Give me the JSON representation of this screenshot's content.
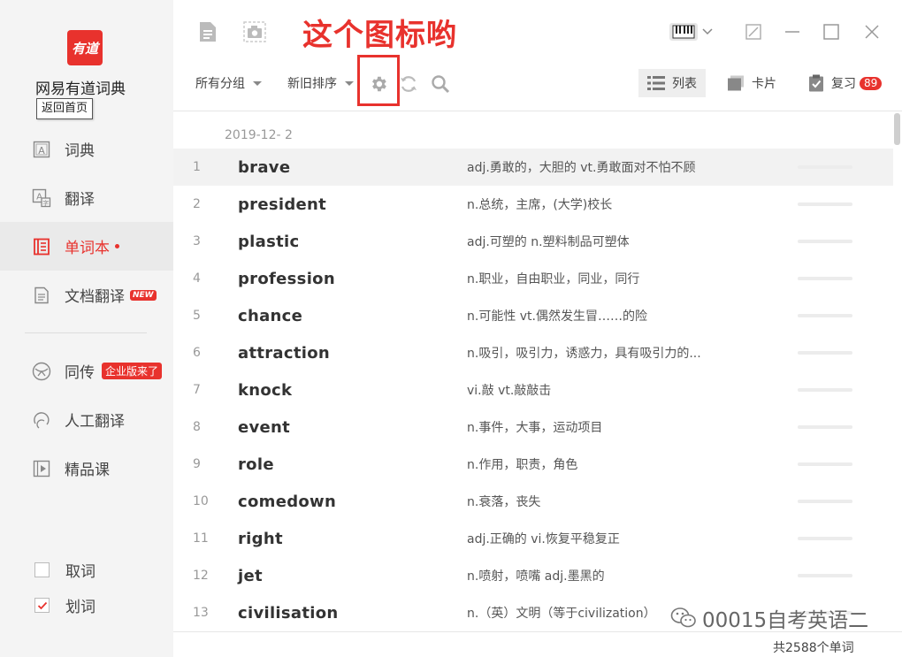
{
  "sidebar": {
    "logo_text": "有道",
    "app_name": "网易有道词典",
    "tooltip": "返回首页",
    "nav": [
      {
        "label": "词典",
        "icon": "dictionary-icon"
      },
      {
        "label": "翻译",
        "icon": "translate-icon"
      },
      {
        "label": "单词本",
        "icon": "wordbook-icon",
        "active": true
      },
      {
        "label": "文档翻译",
        "icon": "document-icon",
        "badge": "NEW"
      },
      {
        "label": "同传",
        "icon": "simultaneous-icon",
        "badge": "企业版来了"
      },
      {
        "label": "人工翻译",
        "icon": "human-translate-icon"
      },
      {
        "label": "精品课",
        "icon": "course-icon"
      }
    ],
    "checks": [
      {
        "label": "取词",
        "checked": false
      },
      {
        "label": "划词",
        "checked": true
      }
    ]
  },
  "header": {
    "annotation": "这个图标哟"
  },
  "toolbar": {
    "group_filter": "所有分组",
    "sort": "新旧排序",
    "view_list": "列表",
    "view_card": "卡片",
    "review": "复习",
    "review_count": "89"
  },
  "list": {
    "date": "2019-12- 2",
    "rows": [
      {
        "num": "1",
        "word": "brave",
        "def": "adj.勇敢的，大胆的 vt.勇敢面对不怕不顾"
      },
      {
        "num": "2",
        "word": "president",
        "def": "n.总统，主席，(大学)校长"
      },
      {
        "num": "3",
        "word": "plastic",
        "def": "adj.可塑的 n.塑料制品可塑体"
      },
      {
        "num": "4",
        "word": "profession",
        "def": "n.职业，自由职业，同业，同行"
      },
      {
        "num": "5",
        "word": "chance",
        "def": "n.可能性 vt.偶然发生冒……的险"
      },
      {
        "num": "6",
        "word": "attraction",
        "def": "n.吸引，吸引力，诱惑力，具有吸引力的..."
      },
      {
        "num": "7",
        "word": "knock",
        "def": "vi.敲 vt.敲敲击"
      },
      {
        "num": "8",
        "word": "event",
        "def": "n.事件，大事，运动项目"
      },
      {
        "num": "9",
        "word": "role",
        "def": "n.作用，职责，角色"
      },
      {
        "num": "10",
        "word": "comedown",
        "def": "n.衰落，丧失"
      },
      {
        "num": "11",
        "word": "right",
        "def": "adj.正确的 vi.恢复平稳复正"
      },
      {
        "num": "12",
        "word": "jet",
        "def": "n.喷射，喷嘴 adj.墨黑的"
      },
      {
        "num": "13",
        "word": "civilisation",
        "def": "n.（英）文明（等于civilization）"
      }
    ],
    "total": "共2588个单词"
  },
  "watermark": "00015自考英语二",
  "colors": {
    "accent": "#e8322d"
  }
}
